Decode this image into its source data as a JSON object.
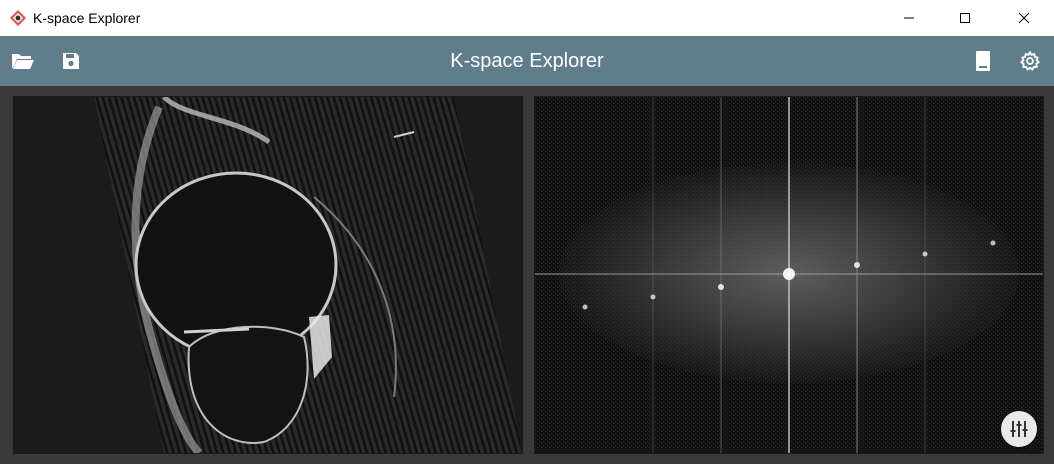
{
  "window": {
    "title": "K-space Explorer",
    "controls": [
      "minimize",
      "maximize",
      "close"
    ]
  },
  "toolbar": {
    "title": "K-space Explorer",
    "left_buttons": [
      "folder-open-icon",
      "save-icon"
    ],
    "right_buttons": [
      "bookmark-icon",
      "gear-icon"
    ],
    "background": "#607d8b"
  },
  "panels": {
    "image": {
      "description_icon": "mri-image"
    },
    "kspace": {
      "description_icon": "kspace-spectrum"
    }
  },
  "fab": {
    "icon": "sliders-icon"
  }
}
